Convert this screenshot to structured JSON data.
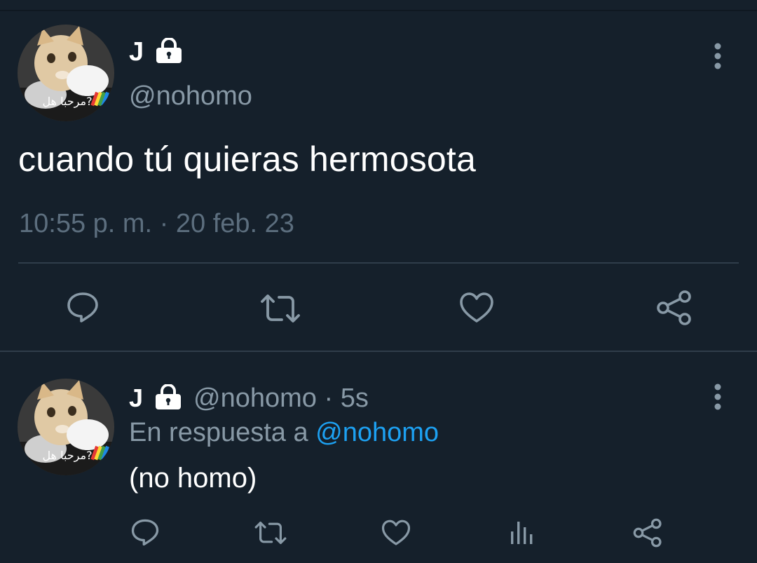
{
  "main_tweet": {
    "display_name": "J",
    "handle": "@nohomo",
    "text": "cuando tú quieras hermosota",
    "meta": "10:55 p. m. · 20 feb. 23",
    "avatar_caption": "?مرحبا هل",
    "actions": [
      "reply-icon",
      "retweet-icon",
      "like-icon",
      "share-icon"
    ]
  },
  "reply_tweet": {
    "display_name": "J",
    "handle_time": "@nohomo · 5s",
    "reply_prefix": "En respuesta a ",
    "reply_to": "@nohomo",
    "text": "(no homo)",
    "avatar_caption": "?مرحبا هل",
    "actions": [
      "reply-icon",
      "retweet-icon",
      "like-icon",
      "analytics-icon",
      "share-icon"
    ]
  },
  "colors": {
    "background": "#15202b",
    "secondary_text": "#8899a6",
    "meta_text": "#5c6e7e",
    "link": "#1da1f2",
    "icon": "#8899a6",
    "divider": "#2f3d4a"
  }
}
